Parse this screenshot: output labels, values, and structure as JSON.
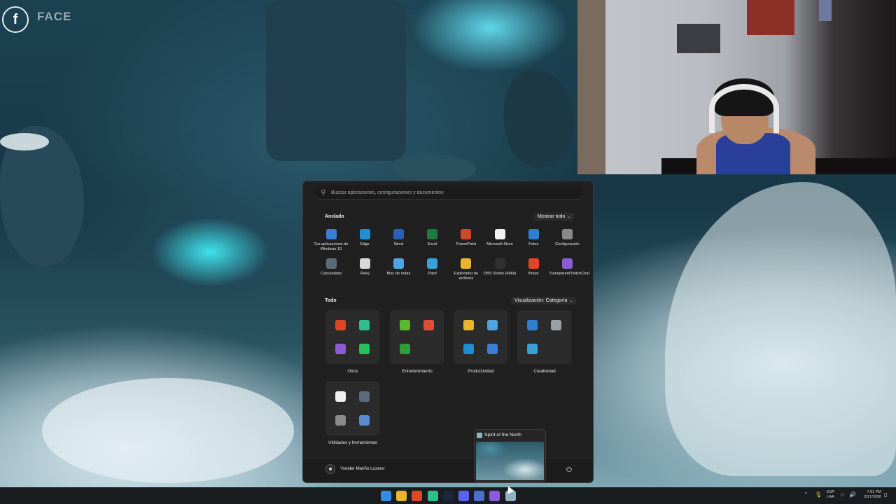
{
  "overlay": {
    "social_text": "FACE"
  },
  "search": {
    "placeholder": "Buscar aplicaciones, configuraciones y documentos"
  },
  "pinned": {
    "title": "Anclado",
    "action": "Mostrar todo",
    "items": [
      {
        "label": "Tus aplicaciones de Windows 10",
        "icon": "windows-apps-icon",
        "color": "#3b7fd4"
      },
      {
        "label": "Edge",
        "icon": "edge-icon",
        "color": "#1e8fd6"
      },
      {
        "label": "Word",
        "icon": "word-icon",
        "color": "#2b5fb8"
      },
      {
        "label": "Excel",
        "icon": "excel-icon",
        "color": "#1f7a44"
      },
      {
        "label": "PowerPoint",
        "icon": "powerpoint-icon",
        "color": "#d1472b"
      },
      {
        "label": "Microsoft Store",
        "icon": "store-icon",
        "color": "#f0f0f0"
      },
      {
        "label": "Fotos",
        "icon": "photos-icon",
        "color": "#2f7fd0"
      },
      {
        "label": "Configuración",
        "icon": "gear-icon",
        "color": "#8a8a8a"
      },
      {
        "label": "Calculadora",
        "icon": "calculator-icon",
        "color": "#5c6a7a"
      },
      {
        "label": "Reloj",
        "icon": "clock-icon",
        "color": "#d8d8d8"
      },
      {
        "label": "Bloc de notas",
        "icon": "notepad-icon",
        "color": "#4ea3e0"
      },
      {
        "label": "Paint",
        "icon": "paint-icon",
        "color": "#3aa0d8"
      },
      {
        "label": "Explorador de archivos",
        "icon": "folder-icon",
        "color": "#e8b530"
      },
      {
        "label": "OBS Studio (64bit)",
        "icon": "obs-icon",
        "color": "#303030"
      },
      {
        "label": "Brave",
        "icon": "brave-icon",
        "color": "#e0452a"
      },
      {
        "label": "TransparentTwitchChat",
        "icon": "twitch-chat-icon",
        "color": "#8a5cd8"
      }
    ]
  },
  "all": {
    "title": "Todo",
    "action": "Visualización: Categoría",
    "categories": [
      {
        "label": "Otros",
        "icons": [
          {
            "name": "brave-icon",
            "color": "#e0452a"
          },
          {
            "name": "game-app-icon",
            "color": "#2fbf8f"
          },
          {
            "name": "twitch-chat-icon",
            "color": "#8a5cd8"
          },
          {
            "name": "whatsapp-group-icon",
            "color": "#25c15a"
          }
        ]
      },
      {
        "label": "Entretenimiento",
        "icons": [
          {
            "name": "xbox-green-icon",
            "color": "#5ab82a"
          },
          {
            "name": "media-player-icon",
            "color": "#e04e35"
          },
          {
            "name": "xbox-icon",
            "color": "#2e9e3a"
          }
        ]
      },
      {
        "label": "Productividad",
        "icons": [
          {
            "name": "folder-icon",
            "color": "#e8b530"
          },
          {
            "name": "notepad-icon",
            "color": "#4ea3e0"
          },
          {
            "name": "edge-icon",
            "color": "#1e8fd6"
          },
          {
            "name": "office-icon",
            "color": "#3b7fd4"
          }
        ]
      },
      {
        "label": "Creatividad",
        "icons": [
          {
            "name": "photos-icon",
            "color": "#2f7fd0"
          },
          {
            "name": "camera-icon",
            "color": "#9aa0a8"
          },
          {
            "name": "paint-icon",
            "color": "#3aa0d8"
          }
        ]
      },
      {
        "label": "Utilidades y herramientas",
        "icons": [
          {
            "name": "store-icon",
            "color": "#f0f0f0"
          },
          {
            "name": "calculator-icon",
            "color": "#5c6a7a"
          },
          {
            "name": "usb-icon",
            "color": "#8a8a8a"
          },
          {
            "name": "tools-icon",
            "color": "#5a8ad0"
          }
        ]
      }
    ]
  },
  "user": {
    "name": "Yoeider Mariño Lozano"
  },
  "preview": {
    "title": "Spirit of the North"
  },
  "taskbar": {
    "apps": [
      {
        "name": "start-button",
        "color": "#2f8fe8"
      },
      {
        "name": "file-explorer-icon",
        "color": "#e8b530"
      },
      {
        "name": "brave-icon",
        "color": "#e0452a"
      },
      {
        "name": "game-app-icon",
        "color": "#2fbf8f"
      },
      {
        "name": "steam-icon",
        "color": "#1b2838"
      },
      {
        "name": "discord-icon",
        "color": "#5865f2"
      },
      {
        "name": "discord-alt-icon",
        "color": "#4a6fd0"
      },
      {
        "name": "twitch-chat-icon",
        "color": "#8a5cd8"
      },
      {
        "name": "spirit-of-the-north-icon",
        "color": "#8fb3bf"
      }
    ],
    "lang_top": "ESP",
    "lang_bottom": "LAA",
    "time": "7:01 PM",
    "date": "3/17/2026"
  }
}
